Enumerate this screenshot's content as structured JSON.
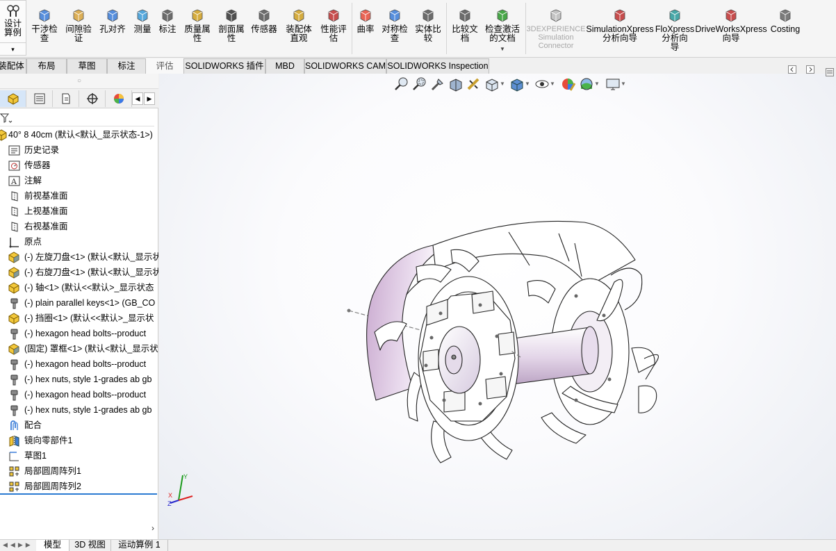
{
  "ribbon": {
    "design_study": "设计算例",
    "buttons": [
      {
        "id": "interference",
        "label_line1": "干涉检",
        "label_line2": "查",
        "icon": "interference-icon"
      },
      {
        "id": "clearance",
        "label_line1": "间隙验",
        "label_line2": "证",
        "icon": "clearance-icon"
      },
      {
        "id": "hole_align",
        "label_line1": "孔对齐",
        "label_line2": "",
        "icon": "hole-align-icon"
      },
      {
        "id": "measure",
        "label_line1": "测量",
        "label_line2": "",
        "icon": "measure-icon"
      },
      {
        "id": "markup",
        "label_line1": "标注",
        "label_line2": "",
        "icon": "markup-icon"
      },
      {
        "id": "mass_props",
        "label_line1": "质量属",
        "label_line2": "性",
        "icon": "mass-properties-icon"
      },
      {
        "id": "section_props",
        "label_line1": "剖面属",
        "label_line2": "性",
        "icon": "section-properties-icon"
      },
      {
        "id": "sensor",
        "label_line1": "传感器",
        "label_line2": "",
        "icon": "sensor-icon"
      },
      {
        "id": "assembly_viz",
        "label_line1": "装配体",
        "label_line2": "直观",
        "icon": "assembly-visualization-icon"
      },
      {
        "id": "performance",
        "label_line1": "性能评",
        "label_line2": "估",
        "icon": "performance-icon"
      },
      {
        "id": "curvature",
        "label_line1": "曲率",
        "label_line2": "",
        "icon": "curvature-icon"
      },
      {
        "id": "symmetry",
        "label_line1": "对称检",
        "label_line2": "查",
        "icon": "symmetry-icon"
      },
      {
        "id": "compare_body",
        "label_line1": "实体比",
        "label_line2": "较",
        "icon": "compare-body-icon"
      },
      {
        "id": "compare_doc",
        "label_line1": "比较文",
        "label_line2": "档",
        "icon": "compare-document-icon"
      },
      {
        "id": "check_active",
        "label_line1": "检查激活",
        "label_line2": "的文档",
        "icon": "check-active-icon"
      },
      {
        "id": "exp_sim",
        "label_line1": "3DEXPERIENCE",
        "label_line2": "Simulation",
        "label_line3": "Connector",
        "icon": "3dexperience-icon"
      },
      {
        "id": "simxpress",
        "label_line1": "SimulationXpress",
        "label_line2": "分析向导",
        "icon": "simulationxpress-icon"
      },
      {
        "id": "floxpress",
        "label_line1": "FloXpress",
        "label_line2": "分析向",
        "label_line3": "导",
        "icon": "floxpress-icon"
      },
      {
        "id": "driveworks",
        "label_line1": "DriveWorksXpress",
        "label_line2": "向导",
        "icon": "driveworks-icon"
      },
      {
        "id": "costing",
        "label_line1": "Costing",
        "label_line2": "",
        "icon": "costing-icon"
      }
    ]
  },
  "tabs": [
    "装配体",
    "布局",
    "草图",
    "标注",
    "评估",
    "SOLIDWORKS 插件",
    "MBD",
    "SOLIDWORKS CAM",
    "SOLIDWORKS Inspection"
  ],
  "active_tab": "评估",
  "tree": {
    "root": "40° 8 40cm  (默认<默认_显示状态-1>)",
    "items": [
      {
        "label": "历史记录",
        "icon": "history-icon"
      },
      {
        "label": "传感器",
        "icon": "sensor-folder-icon"
      },
      {
        "label": "注解",
        "icon": "annotations-icon"
      },
      {
        "label": "前视基准面",
        "icon": "plane-icon"
      },
      {
        "label": "上视基准面",
        "icon": "plane-icon"
      },
      {
        "label": "右视基准面",
        "icon": "plane-icon"
      },
      {
        "label": "原点",
        "icon": "origin-icon"
      },
      {
        "label": "(-) 左旋刀盘<1> (默认<默认_显示状",
        "icon": "subassembly-icon"
      },
      {
        "label": "(-) 右旋刀盘<1> (默认<默认_显示状",
        "icon": "subassembly-icon"
      },
      {
        "label": "(-) 轴<1> (默认<<默认>_显示状态 ",
        "icon": "part-icon"
      },
      {
        "label": "(-) plain parallel keys<1> (GB_CO",
        "icon": "toolbox-part-icon"
      },
      {
        "label": "(-) 挡圈<1> (默认<<默认>_显示状",
        "icon": "part-icon"
      },
      {
        "label": "(-) hexagon head bolts--product",
        "icon": "toolbox-part-icon"
      },
      {
        "label": "(固定) 罩框<1> (默认<默认_显示状",
        "icon": "subassembly-icon"
      },
      {
        "label": "(-) hexagon head bolts--product",
        "icon": "toolbox-part-icon"
      },
      {
        "label": "(-) hex nuts, style 1-grades ab gb",
        "icon": "toolbox-part-icon"
      },
      {
        "label": "(-) hexagon head bolts--product",
        "icon": "toolbox-part-icon"
      },
      {
        "label": "(-) hex nuts, style 1-grades ab gb",
        "icon": "toolbox-part-icon"
      },
      {
        "label": "配合",
        "icon": "mates-icon"
      },
      {
        "label": "镜向零部件1",
        "icon": "mirror-component-icon"
      },
      {
        "label": "草图1",
        "icon": "sketch-icon"
      },
      {
        "label": "局部圆周阵列1",
        "icon": "circular-pattern-icon"
      },
      {
        "label": "局部圆周阵列2",
        "icon": "circular-pattern-icon"
      }
    ]
  },
  "bottom_tabs": [
    "模型",
    "3D 视图",
    "运动算例 1"
  ],
  "active_bottom_tab": "模型",
  "triad": {
    "x": "X",
    "y": "Y",
    "z": "Z"
  },
  "colors": {
    "accent": "#2a7ad2",
    "model_stroke": "#222222",
    "shroud_tint": "#c9a9cf"
  }
}
